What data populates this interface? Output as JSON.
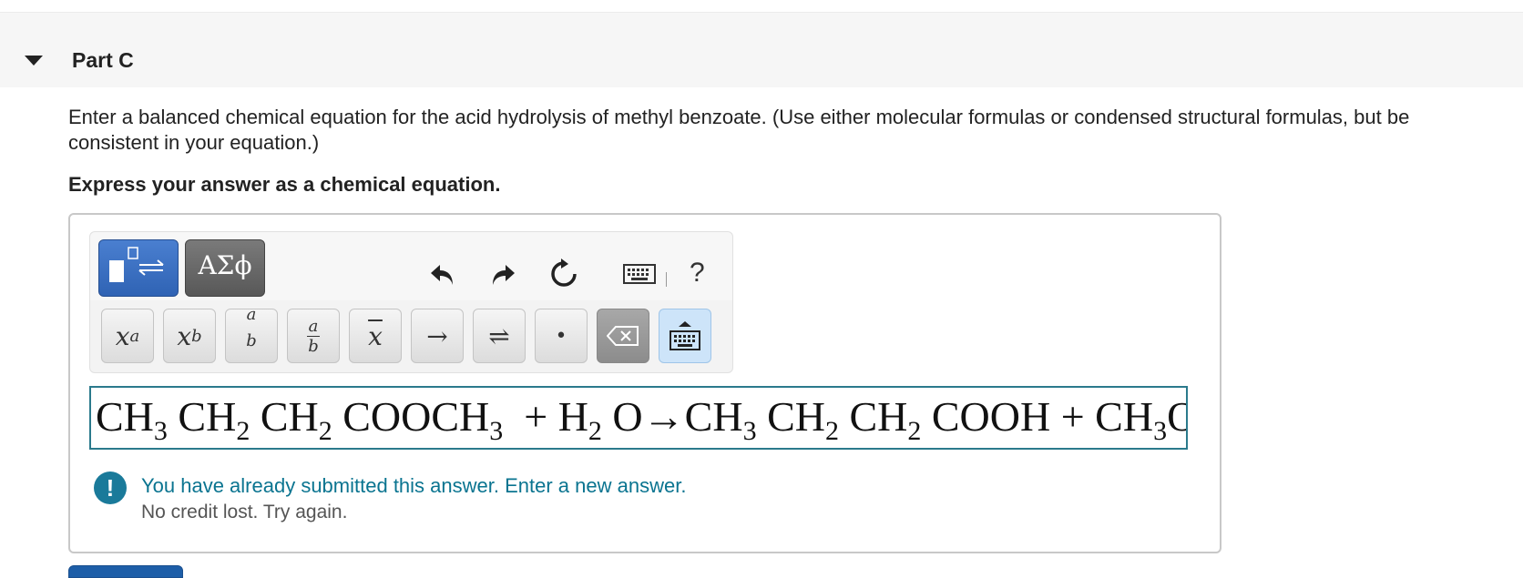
{
  "part": {
    "title": "Part C"
  },
  "question": {
    "text": "Enter a balanced chemical equation for the acid hydrolysis of methyl benzoate. (Use either molecular formulas or condensed structural formulas, but be consistent in your equation.)",
    "instruction": "Express your answer as a chemical equation."
  },
  "toolbar": {
    "greek_label": "ΑΣϕ",
    "help_label": "?",
    "keys": {
      "superscript": "x",
      "superscript_sup": "a",
      "subscript": "x",
      "subscript_sub": "b",
      "upper_top": "a",
      "upper_bottom": "b",
      "frac_top": "a",
      "frac_bottom": "b",
      "bar": "x",
      "arrow": "→",
      "equilibrium": "⇌",
      "dot": "•"
    }
  },
  "answer": {
    "segments": [
      {
        "t": "CH"
      },
      {
        "sub": "3"
      },
      {
        "t": " CH"
      },
      {
        "sub": "2"
      },
      {
        "t": " CH"
      },
      {
        "sub": "2"
      },
      {
        "t": " COOCH"
      },
      {
        "sub": "3"
      },
      {
        "t": "  + H"
      },
      {
        "sub": "2"
      },
      {
        "t": " O"
      },
      {
        "t": "→"
      },
      {
        "t": "CH"
      },
      {
        "sub": "3"
      },
      {
        "t": " CH"
      },
      {
        "sub": "2"
      },
      {
        "t": " CH"
      },
      {
        "sub": "2"
      },
      {
        "t": " COOH + CH"
      },
      {
        "sub": "3"
      },
      {
        "t": "OH"
      }
    ]
  },
  "feedback": {
    "message": "You have already submitted this answer. Enter a new answer.",
    "detail": "No credit lost. Try again.",
    "icon": "!"
  },
  "colors": {
    "accent_blue": "#2f63b4",
    "field_border": "#2b7a8c",
    "feedback_text": "#0a7490"
  }
}
